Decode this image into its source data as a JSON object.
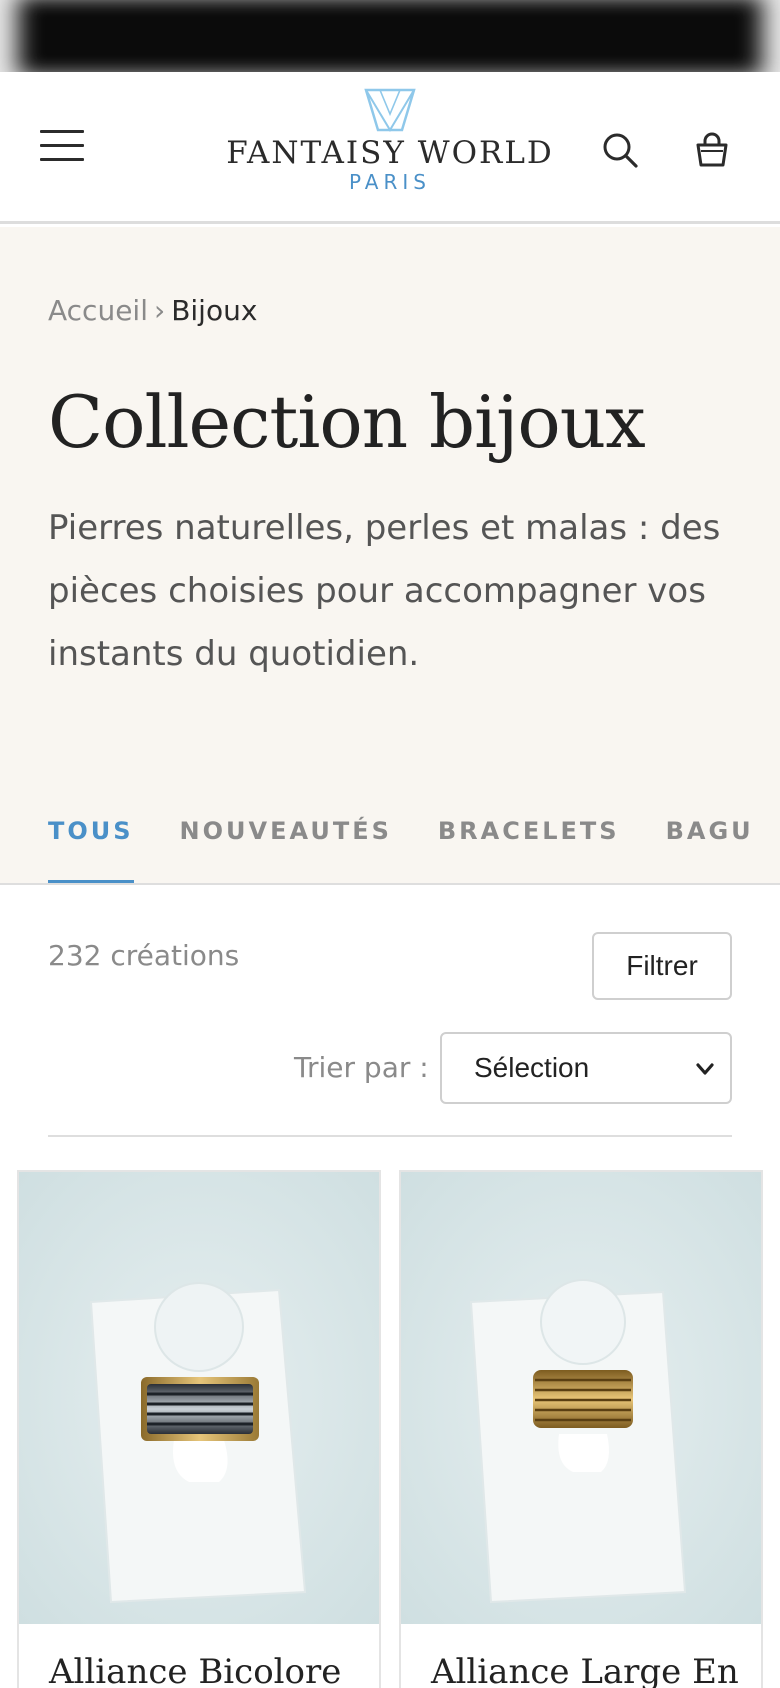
{
  "header": {
    "brand_name": "FANTAISY WORLD",
    "brand_sub": "PARIS",
    "accent_color": "#4a90c8"
  },
  "breadcrumb": {
    "home": "Accueil",
    "separator": "›",
    "current": "Bijoux"
  },
  "collection": {
    "title": "Collection bijoux",
    "description": "Pierres naturelles, perles et malas : des pièces choisies pour accompagner vos instants du quotidien."
  },
  "tabs": [
    {
      "label": "TOUS",
      "active": true
    },
    {
      "label": "NOUVEAUTÉS",
      "active": false
    },
    {
      "label": "BRACELETS",
      "active": false
    },
    {
      "label": "BAGU",
      "active": false
    }
  ],
  "toolbar": {
    "count": "232 créations",
    "filter_label": "Filtrer",
    "sort_label": "Trier par :",
    "sort_value": "Sélection"
  },
  "products": [
    {
      "title": "Alliance Bicolore",
      "icon": "ring-photo"
    },
    {
      "title": "Alliance Large En",
      "icon": "ring-photo"
    }
  ]
}
